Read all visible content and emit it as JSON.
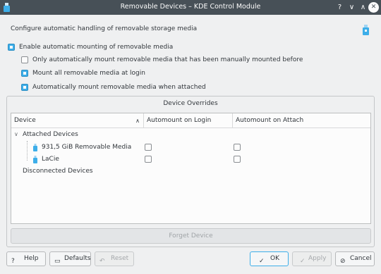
{
  "window": {
    "title": "Removable Devices – KDE Control Module",
    "help_glyph": "?",
    "minimize_glyph": "∨",
    "maximize_glyph": "∧",
    "close_glyph": "✕"
  },
  "heading": "Configure automatic handling of removable storage media",
  "options": {
    "enable_automount": {
      "label": "Enable automatic mounting of removable media",
      "checked": true
    },
    "only_previously_mounted": {
      "label": "Only automatically mount removable media that has been manually mounted before",
      "checked": false
    },
    "mount_at_login": {
      "label": "Mount all removable media at login",
      "checked": true
    },
    "mount_when_attached": {
      "label": "Automatically mount removable media when attached",
      "checked": true
    }
  },
  "overrides": {
    "title": "Device Overrides",
    "columns": [
      "Device",
      "Automount on Login",
      "Automount on Attach"
    ],
    "sort_glyph": "∧",
    "groups": {
      "attached": "Attached Devices",
      "disconnected": "Disconnected Devices"
    },
    "expander_glyph": "∨",
    "devices": [
      {
        "name": "931,5 GiB Removable Media",
        "on_login": false,
        "on_attach": false
      },
      {
        "name": "LaCie",
        "on_login": false,
        "on_attach": false
      }
    ],
    "forget_button": "Forget Device"
  },
  "buttons": {
    "help": {
      "label": "Help",
      "icon": "?"
    },
    "defaults": {
      "label": "Defaults",
      "icon": "▭"
    },
    "reset": {
      "label": "Reset",
      "icon": "↶"
    },
    "ok": {
      "label": "OK",
      "icon": "✓"
    },
    "apply": {
      "label": "Apply",
      "icon": "✓"
    },
    "cancel": {
      "label": "Cancel",
      "icon": "⊘"
    }
  },
  "colors": {
    "accent": "#3daee9",
    "titlebar": "#475057",
    "window_bg": "#eff0f1"
  }
}
